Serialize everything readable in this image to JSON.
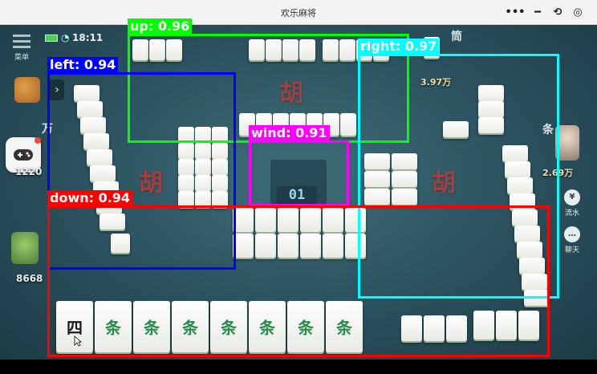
{
  "window": {
    "title": "欢乐麻将"
  },
  "status": {
    "time": "18:11"
  },
  "menu": {
    "label": "菜单"
  },
  "players": {
    "left_score": "1220",
    "bottom_score": "8668",
    "right_score": "2.69万",
    "top_score": "3.97万"
  },
  "table": {
    "hu_mark": "胡",
    "remaining_tiles": "01",
    "right_flag": "条",
    "top_flag": "筒",
    "left_flag": "万"
  },
  "side_buttons": {
    "flow_label": "流水",
    "chat_label": "聊天"
  },
  "detections": [
    {
      "name": "up",
      "label": "up: 0.96",
      "color": "#00ff00"
    },
    {
      "name": "left",
      "label": "left: 0.94",
      "color": "#0000ff"
    },
    {
      "name": "right",
      "label": "right: 0.97",
      "color": "#00ffff"
    },
    {
      "name": "wind",
      "label": "wind: 0.91",
      "color": "#ff00ff"
    },
    {
      "name": "down",
      "label": "down: 0.94",
      "color": "#ff0000"
    }
  ],
  "hand_tiles": [
    "四",
    "条",
    "条",
    "条",
    "条",
    "条",
    "条",
    "条"
  ],
  "colors": {
    "up": "#00ff00",
    "left": "#0000ff",
    "right": "#00ffff",
    "wind": "#ff00ff",
    "down": "#ff0000"
  }
}
